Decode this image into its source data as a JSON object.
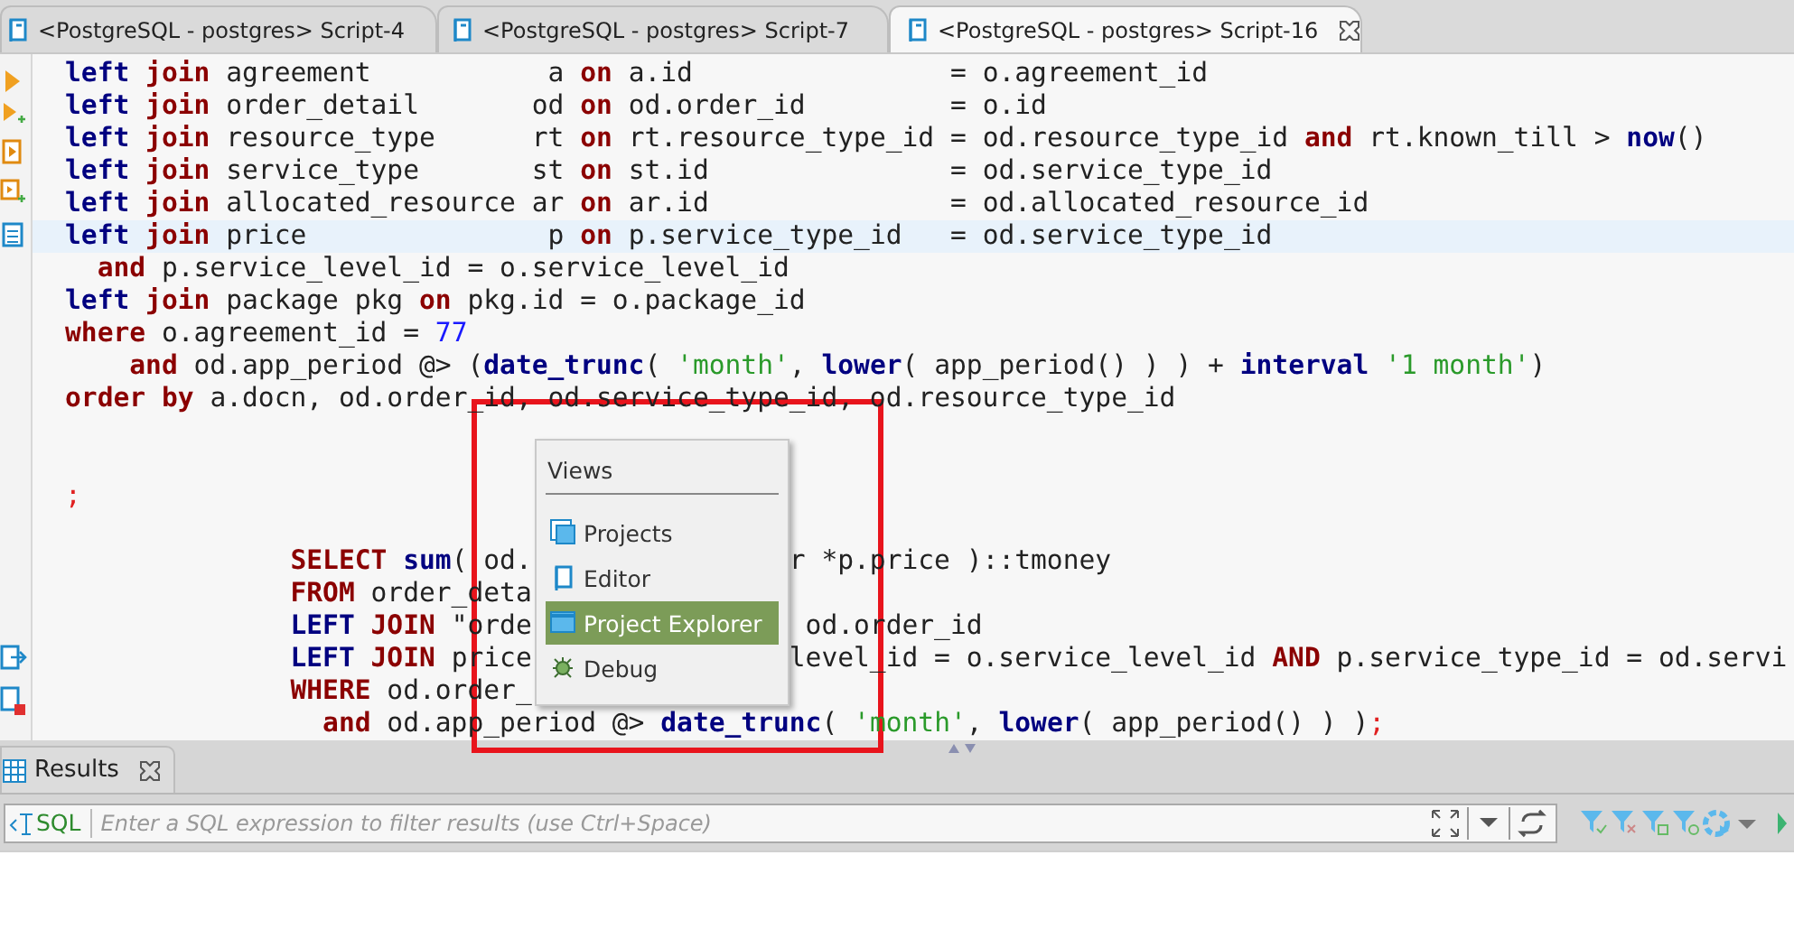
{
  "tabs": [
    {
      "title": "<PostgreSQL - postgres> Script-4",
      "selected": false
    },
    {
      "title": "<PostgreSQL - postgres> Script-7",
      "selected": false
    },
    {
      "title": "<PostgreSQL - postgres> Script-16",
      "selected": true
    }
  ],
  "editor": {
    "lines": [
      {
        "current": false,
        "tokens": [
          {
            "kind": "builtin",
            "text": "left"
          },
          {
            "kind": "keyword",
            "text": " join"
          },
          {
            "kind": "plain",
            "text": " agreement           a"
          },
          {
            "kind": "keyword",
            "text": " on"
          },
          {
            "kind": "plain",
            "text": " a.id                = o.agreement_id"
          }
        ]
      },
      {
        "current": false,
        "tokens": [
          {
            "kind": "builtin",
            "text": "left"
          },
          {
            "kind": "keyword",
            "text": " join"
          },
          {
            "kind": "plain",
            "text": " order_detail       od"
          },
          {
            "kind": "keyword",
            "text": " on"
          },
          {
            "kind": "plain",
            "text": " od.order_id         = o.id"
          }
        ]
      },
      {
        "current": false,
        "tokens": [
          {
            "kind": "builtin",
            "text": "left"
          },
          {
            "kind": "keyword",
            "text": " join"
          },
          {
            "kind": "plain",
            "text": " resource_type      rt"
          },
          {
            "kind": "keyword",
            "text": " on"
          },
          {
            "kind": "plain",
            "text": " rt.resource_type_id = od.resource_type_id"
          },
          {
            "kind": "keyword",
            "text": " and"
          },
          {
            "kind": "plain",
            "text": " rt.known_till >"
          },
          {
            "kind": "builtin",
            "text": " now"
          },
          {
            "kind": "plain",
            "text": "()"
          }
        ]
      },
      {
        "current": false,
        "tokens": [
          {
            "kind": "builtin",
            "text": "left"
          },
          {
            "kind": "keyword",
            "text": " join"
          },
          {
            "kind": "plain",
            "text": " service_type       st"
          },
          {
            "kind": "keyword",
            "text": " on"
          },
          {
            "kind": "plain",
            "text": " st.id               = od.service_type_id"
          }
        ]
      },
      {
        "current": false,
        "tokens": [
          {
            "kind": "builtin",
            "text": "left"
          },
          {
            "kind": "keyword",
            "text": " join"
          },
          {
            "kind": "plain",
            "text": " allocated_resource ar"
          },
          {
            "kind": "keyword",
            "text": " on"
          },
          {
            "kind": "plain",
            "text": " ar.id               = od.allocated_resource_id"
          }
        ]
      },
      {
        "current": true,
        "tokens": [
          {
            "kind": "builtin",
            "text": "left"
          },
          {
            "kind": "keyword",
            "text": " join"
          },
          {
            "kind": "plain",
            "text": " price               p"
          },
          {
            "kind": "keyword",
            "text": " on"
          },
          {
            "kind": "plain",
            "text": " p.service_type_id   = od.service_type_id"
          }
        ]
      },
      {
        "current": false,
        "tokens": [
          {
            "kind": "keyword",
            "text": "  and"
          },
          {
            "kind": "plain",
            "text": " p.service_level_id = o.service_level_id"
          }
        ]
      },
      {
        "current": false,
        "tokens": [
          {
            "kind": "builtin",
            "text": "left"
          },
          {
            "kind": "keyword",
            "text": " join"
          },
          {
            "kind": "plain",
            "text": " package pkg"
          },
          {
            "kind": "keyword",
            "text": " on"
          },
          {
            "kind": "plain",
            "text": " pkg.id = o.package_id"
          }
        ]
      },
      {
        "current": false,
        "tokens": [
          {
            "kind": "keyword",
            "text": "where"
          },
          {
            "kind": "plain",
            "text": " o.agreement_id ="
          },
          {
            "kind": "number",
            "text": " 77"
          }
        ]
      },
      {
        "current": false,
        "tokens": [
          {
            "kind": "keyword",
            "text": "    and"
          },
          {
            "kind": "plain",
            "text": " od.app_period @> ("
          },
          {
            "kind": "builtin",
            "text": "date_trunc"
          },
          {
            "kind": "plain",
            "text": "( "
          },
          {
            "kind": "string",
            "text": "'month'"
          },
          {
            "kind": "plain",
            "text": ", "
          },
          {
            "kind": "builtin",
            "text": "lower"
          },
          {
            "kind": "plain",
            "text": "( app_period() ) ) +"
          },
          {
            "kind": "builtin",
            "text": " interval"
          },
          {
            "kind": "string",
            "text": " '1 month'"
          },
          {
            "kind": "plain",
            "text": ")"
          }
        ]
      },
      {
        "current": false,
        "tokens": [
          {
            "kind": "keyword",
            "text": "order by"
          },
          {
            "kind": "plain",
            "text": " a.docn, od.order_id, od.service_type_id, od.resource_type_id"
          }
        ]
      },
      {
        "current": false
      },
      {
        "current": false
      },
      {
        "current": false,
        "tokens": [
          {
            "kind": "delimiter",
            "text": ";"
          }
        ]
      },
      {
        "current": false
      },
      {
        "current": false,
        "tokens": [
          {
            "kind": "keyword",
            "text": "              SELECT"
          },
          {
            "kind": "builtin",
            "text": " sum"
          },
          {
            "kind": "plain",
            "text": "( od."
          }
        ],
        "tokens_right": [
          {
            "kind": "plain",
            "text": "r *p.price )::tmoney"
          }
        ]
      },
      {
        "current": false,
        "tokens": [
          {
            "kind": "keyword",
            "text": "              FROM"
          },
          {
            "kind": "plain",
            "text": " order_deta"
          }
        ]
      },
      {
        "current": false,
        "tokens": [
          {
            "kind": "builtin",
            "text": "              LEFT"
          },
          {
            "kind": "keyword",
            "text": " JOIN"
          },
          {
            "kind": "plain",
            "text": " \"orde"
          }
        ],
        "tokens_right": [
          {
            "kind": "plain",
            "text": " od.order_id"
          }
        ]
      },
      {
        "current": false,
        "tokens": [
          {
            "kind": "builtin",
            "text": "              LEFT"
          },
          {
            "kind": "keyword",
            "text": " JOIN"
          },
          {
            "kind": "plain",
            "text": " price"
          }
        ],
        "tokens_right": [
          {
            "kind": "plain",
            "text": "level_id = o.service_level_id"
          },
          {
            "kind": "keyword",
            "text": " AND"
          },
          {
            "kind": "plain",
            "text": " p.service_type_id = od.servi"
          }
        ]
      },
      {
        "current": false,
        "tokens": [
          {
            "kind": "keyword",
            "text": "              WHERE"
          },
          {
            "kind": "plain",
            "text": " od.order_"
          }
        ]
      },
      {
        "current": false,
        "tokens": [
          {
            "kind": "keyword",
            "text": "                and"
          },
          {
            "kind": "plain",
            "text": " od.app_period @>"
          },
          {
            "kind": "builtin",
            "text": " date_trunc"
          },
          {
            "kind": "plain",
            "text": "( "
          },
          {
            "kind": "string",
            "text": "'month'"
          },
          {
            "kind": "plain",
            "text": ", "
          },
          {
            "kind": "builtin",
            "text": "lower"
          },
          {
            "kind": "plain",
            "text": "( app_period() ) )"
          },
          {
            "kind": "delimiter",
            "text": ";"
          }
        ]
      }
    ]
  },
  "views_popup": {
    "title": "Views",
    "items": [
      {
        "label": "Projects",
        "selected": false
      },
      {
        "label": "Editor",
        "selected": false
      },
      {
        "label": "Project Explorer",
        "selected": true
      },
      {
        "label": "Debug",
        "selected": false
      }
    ]
  },
  "results_panel": {
    "tab": {
      "label": "Results"
    },
    "filter": {
      "label": "SQL",
      "placeholder": "Enter a SQL expression to filter results (use Ctrl+Space)"
    }
  }
}
